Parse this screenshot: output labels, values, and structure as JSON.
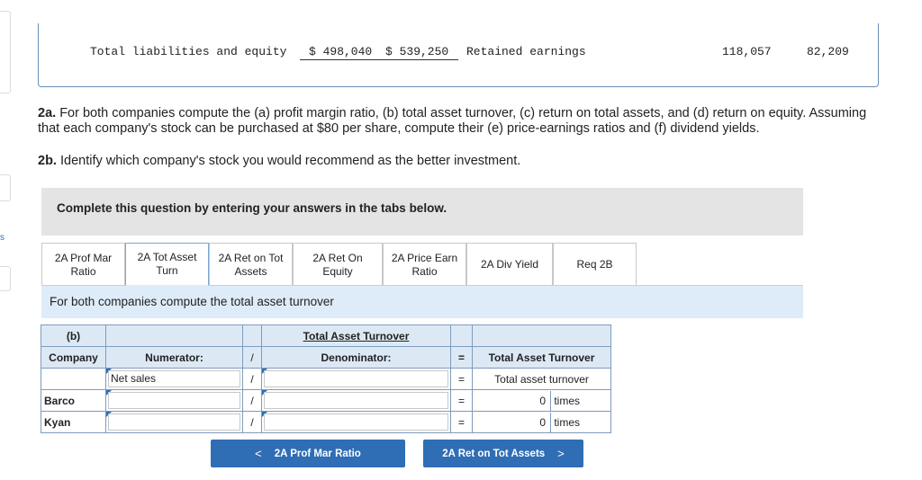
{
  "statement": {
    "label": "Total liabilities and equity",
    "barco_value": "$ 498,040",
    "kyan_value": "$ 539,250",
    "right_label": "Retained earnings",
    "right_barco": "118,057",
    "right_kyan": "82,209"
  },
  "prompt": {
    "p2a_num": "2a.",
    "p2a_text": "For both companies compute the (a) profit margin ratio, (b) total asset turnover, (c) return on total assets, and (d) return on equity. Assuming that each company's stock can be purchased at $80 per share, compute their (e) price-earnings ratios and (f) dividend yields.",
    "p2b_num": "2b.",
    "p2b_text": "Identify which company's stock you would recommend as the better investment."
  },
  "instructions": "Complete this question by entering your answers in the tabs below.",
  "tabs": [
    {
      "line1": "2A Prof Mar",
      "line2": "Ratio"
    },
    {
      "line1": "2A Tot Asset",
      "line2": "Turn"
    },
    {
      "line1": "2A Ret on Tot",
      "line2": "Assets"
    },
    {
      "line1": "2A Ret On",
      "line2": "Equity"
    },
    {
      "line1": "2A Price Earn",
      "line2": "Ratio"
    },
    {
      "line1": "2A Div Yield",
      "line2": ""
    },
    {
      "line1": "Req 2B",
      "line2": ""
    }
  ],
  "sub_instruction": "For both companies compute the total asset turnover",
  "table": {
    "part": "(b)",
    "title": "Total Asset Turnover",
    "company_header": "Company",
    "numerator_header": "Numerator:",
    "slash": "/",
    "denominator_header": "Denominator:",
    "equals": "=",
    "result_header": "Total Asset Turnover",
    "numerator_label": "Net sales",
    "denominator_label": "",
    "result_label": "Total asset turnover",
    "rows": [
      {
        "company": "Barco",
        "numerator": "",
        "denominator": "",
        "result": "0",
        "unit": "times"
      },
      {
        "company": "Kyan",
        "numerator": "",
        "denominator": "",
        "result": "0",
        "unit": "times"
      }
    ]
  },
  "nav": {
    "prev_label": "2A Prof Mar Ratio",
    "prev_arrow": "<",
    "next_label": "2A Ret on Tot Assets",
    "next_arrow": ">"
  },
  "edge_letter": "s"
}
